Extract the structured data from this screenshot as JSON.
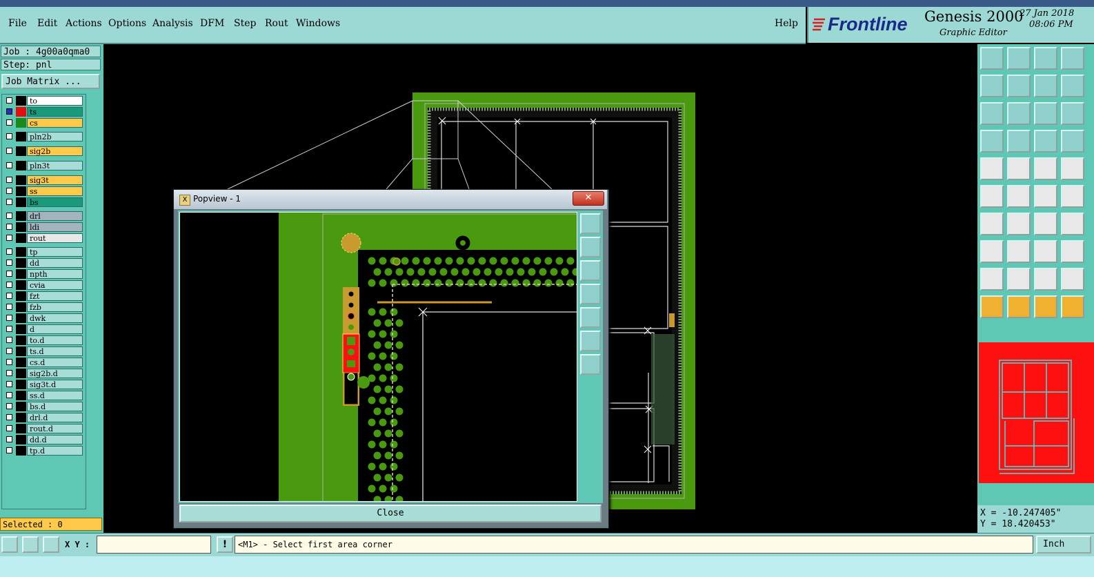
{
  "menubar": {
    "items": [
      "File",
      "Edit",
      "Actions",
      "Options",
      "Analysis",
      "DFM",
      "Step",
      "Rout",
      "Windows"
    ],
    "help": "Help"
  },
  "brand": {
    "logo_text": "Frontline",
    "product": "Genesis 2000",
    "subtitle": "Graphic Editor",
    "date": "27 Jan 2018",
    "time": "08:06 PM"
  },
  "job": {
    "job_label": "Job : 4g00a0qma0",
    "step_label": "Step: pnl",
    "matrix_button": "Job Matrix ..."
  },
  "layers": [
    {
      "name": "to",
      "color": "#ffffff"
    },
    {
      "name": "ts",
      "color": "#1a9a7a"
    },
    {
      "name": "cs",
      "color": "#ffc94a"
    },
    {
      "name": "pln2b",
      "color": "#a8dcd6"
    },
    {
      "name": "sig2b",
      "color": "#ffc94a"
    },
    {
      "name": "pln3t",
      "color": "#a8dcd6"
    },
    {
      "name": "sig3t",
      "color": "#ffc94a"
    },
    {
      "name": "ss",
      "color": "#ffc94a"
    },
    {
      "name": "bs",
      "color": "#1a9a7a"
    },
    {
      "name": "drl",
      "color": "#a4b4bc"
    },
    {
      "name": "ldi",
      "color": "#a4b4bc"
    },
    {
      "name": "rout",
      "color": "#e8e8e8"
    },
    {
      "name": "tp",
      "color": "#a8dcd6"
    },
    {
      "name": "dd",
      "color": "#a8dcd6"
    },
    {
      "name": "npth",
      "color": "#a8dcd6"
    },
    {
      "name": "cvia",
      "color": "#a8dcd6"
    },
    {
      "name": "fzt",
      "color": "#a8dcd6"
    },
    {
      "name": "fzb",
      "color": "#a8dcd6"
    },
    {
      "name": "dwk",
      "color": "#a8dcd6"
    },
    {
      "name": "d",
      "color": "#a8dcd6"
    },
    {
      "name": "to.d",
      "color": "#a8dcd6"
    },
    {
      "name": "ts.d",
      "color": "#a8dcd6"
    },
    {
      "name": "cs.d",
      "color": "#a8dcd6"
    },
    {
      "name": "sig2b.d",
      "color": "#a8dcd6"
    },
    {
      "name": "sig3t.d",
      "color": "#a8dcd6"
    },
    {
      "name": "ss.d",
      "color": "#a8dcd6"
    },
    {
      "name": "bs.d",
      "color": "#a8dcd6"
    },
    {
      "name": "drl.d",
      "color": "#a8dcd6"
    },
    {
      "name": "rout.d",
      "color": "#a8dcd6"
    },
    {
      "name": "dd.d",
      "color": "#a8dcd6"
    },
    {
      "name": "tp.d",
      "color": "#a8dcd6"
    }
  ],
  "selected": "Selected : 0",
  "popview": {
    "title": "Popview - 1",
    "close_label": "Close",
    "close_x": "✕"
  },
  "coords": {
    "x": "X = -10.247405\"",
    "y": "Y = 18.420453\""
  },
  "statusbar": {
    "xy_label": "X Y :",
    "xy_value": "",
    "info_icon": "!",
    "prompt": "<M1> - Select first area corner",
    "units": "Inch"
  },
  "colors": {
    "panel": "#5ec8b4",
    "board_green": "#4a9a10",
    "copper": "#c89a30",
    "highlight_red": "#ff1010"
  }
}
